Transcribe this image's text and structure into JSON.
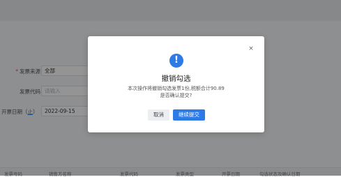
{
  "form": {
    "invoice_source": {
      "label": "发票来源",
      "value": "全部"
    },
    "invoice_code": {
      "label": "发票代码",
      "placeholder": "请输入"
    },
    "issue_date": {
      "label_prefix": "开票日期（",
      "label_link": "止",
      "label_suffix": "）",
      "value": "2022-09-15"
    }
  },
  "table": {
    "headers": [
      "发票号码",
      "销售方名称",
      "发票代码",
      "发票类型",
      "开票日期",
      "勾选状态及确认日期"
    ]
  },
  "dialog": {
    "icon": "exclamation-icon",
    "close_glyph": "×",
    "title": "撤销勾选",
    "message_line1": "本次操作将撤销勾选发票1份,税额合计90.89",
    "message_line2": "是否确认提交?",
    "cancel_label": "取消",
    "confirm_label": "继续提交"
  },
  "colors": {
    "accent": "#2f7be6",
    "required": "#e34d4d",
    "overlay": "rgba(0,0,0,0.42)"
  }
}
